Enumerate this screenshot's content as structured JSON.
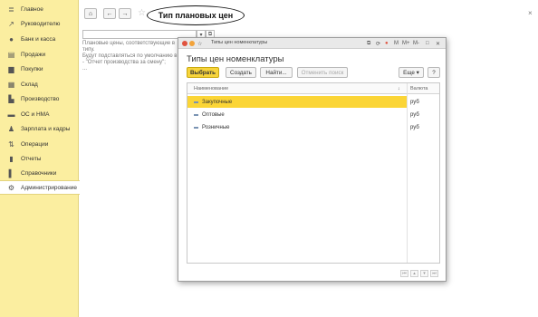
{
  "sidebar": {
    "items": [
      {
        "label": "Главное",
        "icon": "list-icon",
        "glyph": "≣",
        "active": false
      },
      {
        "label": "Руководителю",
        "icon": "trend-chart-icon",
        "glyph": "↗",
        "active": false
      },
      {
        "label": "Банк и касса",
        "icon": "coins-icon",
        "glyph": "●",
        "active": false
      },
      {
        "label": "Продажи",
        "icon": "cart-icon",
        "glyph": "▤",
        "active": false
      },
      {
        "label": "Покупки",
        "icon": "truck-icon",
        "glyph": "▆",
        "active": false
      },
      {
        "label": "Склад",
        "icon": "warehouse-icon",
        "glyph": "▦",
        "active": false
      },
      {
        "label": "Производство",
        "icon": "factory-icon",
        "glyph": "▙",
        "active": false
      },
      {
        "label": "ОС и НМА",
        "icon": "car-icon",
        "glyph": "▬",
        "active": false
      },
      {
        "label": "Зарплата и кадры",
        "icon": "person-icon",
        "glyph": "♟",
        "active": false
      },
      {
        "label": "Операции",
        "icon": "operations-icon",
        "glyph": "⇅",
        "active": false
      },
      {
        "label": "Отчеты",
        "icon": "bar-chart-icon",
        "glyph": "▮",
        "active": false
      },
      {
        "label": "Справочники",
        "icon": "book-icon",
        "glyph": "▌",
        "active": false
      },
      {
        "label": "Администрирование",
        "icon": "gear-icon",
        "glyph": "⚙",
        "active": true
      }
    ]
  },
  "header": {
    "home_glyph": "⌂",
    "back_glyph": "←",
    "forward_glyph": "→",
    "star_glyph": "☆",
    "title": "Тип плановых цен",
    "close_glyph": "×"
  },
  "background_form": {
    "input_value": "",
    "dropdown_glyph": "▾",
    "open_glyph": "⧉",
    "description_lines": [
      "Плановые цены, соответствующие в",
      "типу.",
      "Будут подставляться по умолчанию в",
      "- \"Отчет производства за смену\";",
      "..."
    ]
  },
  "modal": {
    "window_title": "Типы цен номенклатуры",
    "heading": "Типы цен номенклатуры",
    "titlebar_buttons": {
      "restore": "⧉",
      "star": "☆",
      "link": "⟳",
      "m": "M",
      "mplus": "M+",
      "mminus": "M-",
      "maximize": "□",
      "close": "✕"
    },
    "toolbar": {
      "select": "Выбрать",
      "create": "Создать",
      "find": "Найти...",
      "cancel_search": "Отменить поиск",
      "more": "Еще ▾",
      "help": "?"
    },
    "table": {
      "columns": {
        "name": "Наименование",
        "sort_glyph": "↓",
        "currency": "Валюта"
      },
      "rows": [
        {
          "name": "Закупочные",
          "currency": "руб",
          "selected": true
        },
        {
          "name": "Оптовые",
          "currency": "руб",
          "selected": false
        },
        {
          "name": "Розничные",
          "currency": "руб",
          "selected": false
        }
      ]
    },
    "pager": [
      "⏮",
      "▴",
      "▾",
      "⏭"
    ]
  },
  "colors": {
    "sidebar_bg": "#fbeea0",
    "accent_yellow": "#f7d43c",
    "selected_row": "#fbd536"
  }
}
